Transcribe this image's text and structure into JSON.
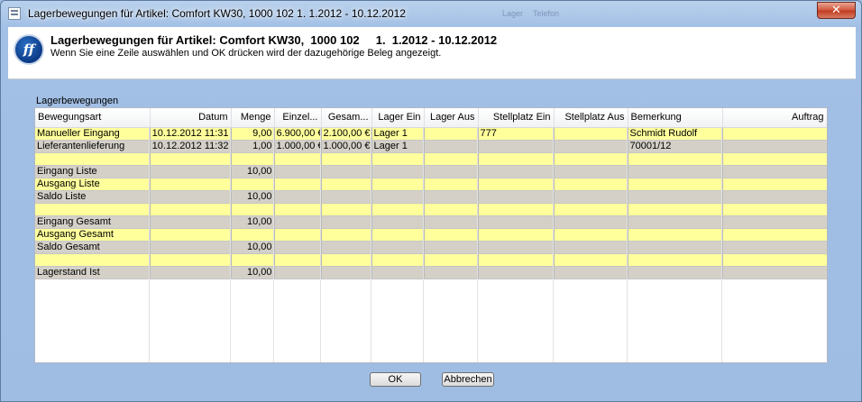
{
  "window": {
    "title": "Lagerbewegungen für Artikel: Comfort KW30,  1000 102     1.  1.2012 - 10.12.2012",
    "ghost_texts": [
      "Lager",
      "Telefon"
    ],
    "close_symbol": "✕"
  },
  "header": {
    "logo_text": "ff",
    "title": "Lagerbewegungen für Artikel: Comfort KW30,  1000 102     1.  1.2012 - 10.12.2012",
    "subtitle": "Wenn Sie eine Zeile auswählen und OK drücken wird der dazugehörige Beleg angezeigt."
  },
  "group_label": "Lagerbewegungen",
  "columns": [
    "Bewegungsart",
    "Datum",
    "Menge",
    "Einzel...",
    "Gesam...",
    "Lager Ein",
    "Lager Aus",
    "Stellplatz Ein",
    "Stellplatz Aus",
    "Bemerkung",
    "Auftrag"
  ],
  "rows": [
    {
      "style": "y",
      "cells": [
        "Manueller Eingang",
        "10.12.2012  11:31",
        "9,00",
        "6.900,00 €",
        "2.100,00 €",
        "Lager 1",
        "",
        "777",
        "",
        "Schmidt Rudolf",
        ""
      ]
    },
    {
      "style": "g",
      "cells": [
        "Lieferantenlieferung",
        "10.12.2012  11:32",
        "1,00",
        "1.000,00 €",
        "1.000,00 €",
        "Lager 1",
        "",
        "",
        "",
        "70001/12",
        ""
      ]
    },
    {
      "style": "y",
      "cells": [
        "",
        "",
        "",
        "",
        "",
        "",
        "",
        "",
        "",
        "",
        ""
      ]
    },
    {
      "style": "g",
      "cells": [
        "Eingang Liste",
        "",
        "10,00",
        "",
        "",
        "",
        "",
        "",
        "",
        "",
        ""
      ]
    },
    {
      "style": "y",
      "cells": [
        "Ausgang Liste",
        "",
        "",
        "",
        "",
        "",
        "",
        "",
        "",
        "",
        ""
      ]
    },
    {
      "style": "g",
      "cells": [
        "Saldo Liste",
        "",
        "10,00",
        "",
        "",
        "",
        "",
        "",
        "",
        "",
        ""
      ]
    },
    {
      "style": "y",
      "cells": [
        "",
        "",
        "",
        "",
        "",
        "",
        "",
        "",
        "",
        "",
        ""
      ]
    },
    {
      "style": "g",
      "cells": [
        "Eingang Gesamt",
        "",
        "10,00",
        "",
        "",
        "",
        "",
        "",
        "",
        "",
        ""
      ]
    },
    {
      "style": "y",
      "cells": [
        "Ausgang Gesamt",
        "",
        "",
        "",
        "",
        "",
        "",
        "",
        "",
        "",
        ""
      ]
    },
    {
      "style": "g",
      "cells": [
        "Saldo Gesamt",
        "",
        "10,00",
        "",
        "",
        "",
        "",
        "",
        "",
        "",
        ""
      ]
    },
    {
      "style": "y",
      "cells": [
        "",
        "",
        "",
        "",
        "",
        "",
        "",
        "",
        "",
        "",
        ""
      ]
    },
    {
      "style": "g",
      "cells": [
        "Lagerstand Ist",
        "",
        "10,00",
        "",
        "",
        "",
        "",
        "",
        "",
        "",
        ""
      ]
    }
  ],
  "buttons": {
    "ok": "OK",
    "cancel": "Abbrechen"
  },
  "colors": {
    "row_yellow": "#ffff9c",
    "row_gray": "#d4d0c8",
    "background": "#9fbde3"
  }
}
